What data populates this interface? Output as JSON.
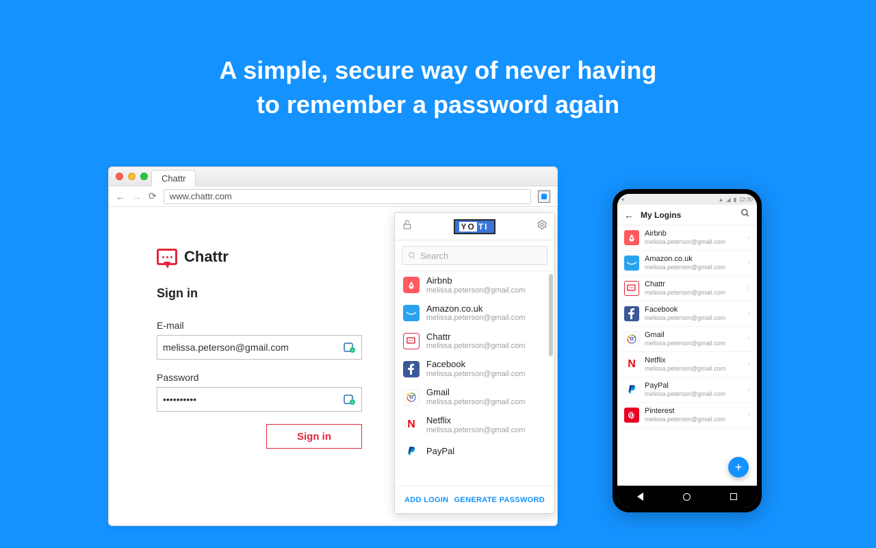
{
  "headline": {
    "line1": "A simple, secure way of never having",
    "line2": "to remember a password again"
  },
  "browser": {
    "tab_title": "Chattr",
    "url": "www.chattr.com"
  },
  "page": {
    "app_name": "Chattr",
    "signin_heading": "Sign in",
    "email_label": "E-mail",
    "email_value": "melissa.peterson@gmail.com",
    "password_label": "Password",
    "password_value": "••••••••••",
    "signin_button": "Sign in"
  },
  "popup": {
    "brand_left": "YO",
    "brand_right": "TI",
    "search_placeholder": "Search",
    "items": [
      {
        "name": "Airbnb",
        "sub": "melissa.peterson@gmail.com",
        "icon": "airbnb"
      },
      {
        "name": "Amazon.co.uk",
        "sub": "melissa.peterson@gmail.com",
        "icon": "amazon"
      },
      {
        "name": "Chattr",
        "sub": "melissa.peterson@gmail.com",
        "icon": "chattr"
      },
      {
        "name": "Facebook",
        "sub": "melissa.peterson@gmail.com",
        "icon": "fb"
      },
      {
        "name": "Gmail",
        "sub": "melissa.peterson@gmail.com",
        "icon": "gmail"
      },
      {
        "name": "Netflix",
        "sub": "melissa.peterson@gmail.com",
        "icon": "netflix"
      },
      {
        "name": "PayPal",
        "sub": "",
        "icon": "paypal"
      }
    ],
    "add_login": "ADD LOGIN",
    "generate_password": "GENERATE PASSWORD"
  },
  "phone": {
    "status_time": "12:30",
    "appbar_title": "My Logins",
    "items": [
      {
        "name": "Airbnb",
        "sub": "melissa.peterson@gmail.com",
        "icon": "airbnb"
      },
      {
        "name": "Amazon.co.uk",
        "sub": "melissa.peterson@gmail.com",
        "icon": "amazon"
      },
      {
        "name": "Chattr",
        "sub": "melissa.peterson@gmail.com",
        "icon": "chattr"
      },
      {
        "name": "Facebook",
        "sub": "melissa.peterson@gmail.com",
        "icon": "fb"
      },
      {
        "name": "Gmail",
        "sub": "melissa.peterson@gmail.com",
        "icon": "gmail"
      },
      {
        "name": "Netflix",
        "sub": "melissa.peterson@gmail.com",
        "icon": "netflix"
      },
      {
        "name": "PayPal",
        "sub": "melissa.peterson@gmail.com",
        "icon": "paypal"
      },
      {
        "name": "Pinterest",
        "sub": "melissa.peterson@gmail.com",
        "icon": "pinterest"
      }
    ]
  }
}
